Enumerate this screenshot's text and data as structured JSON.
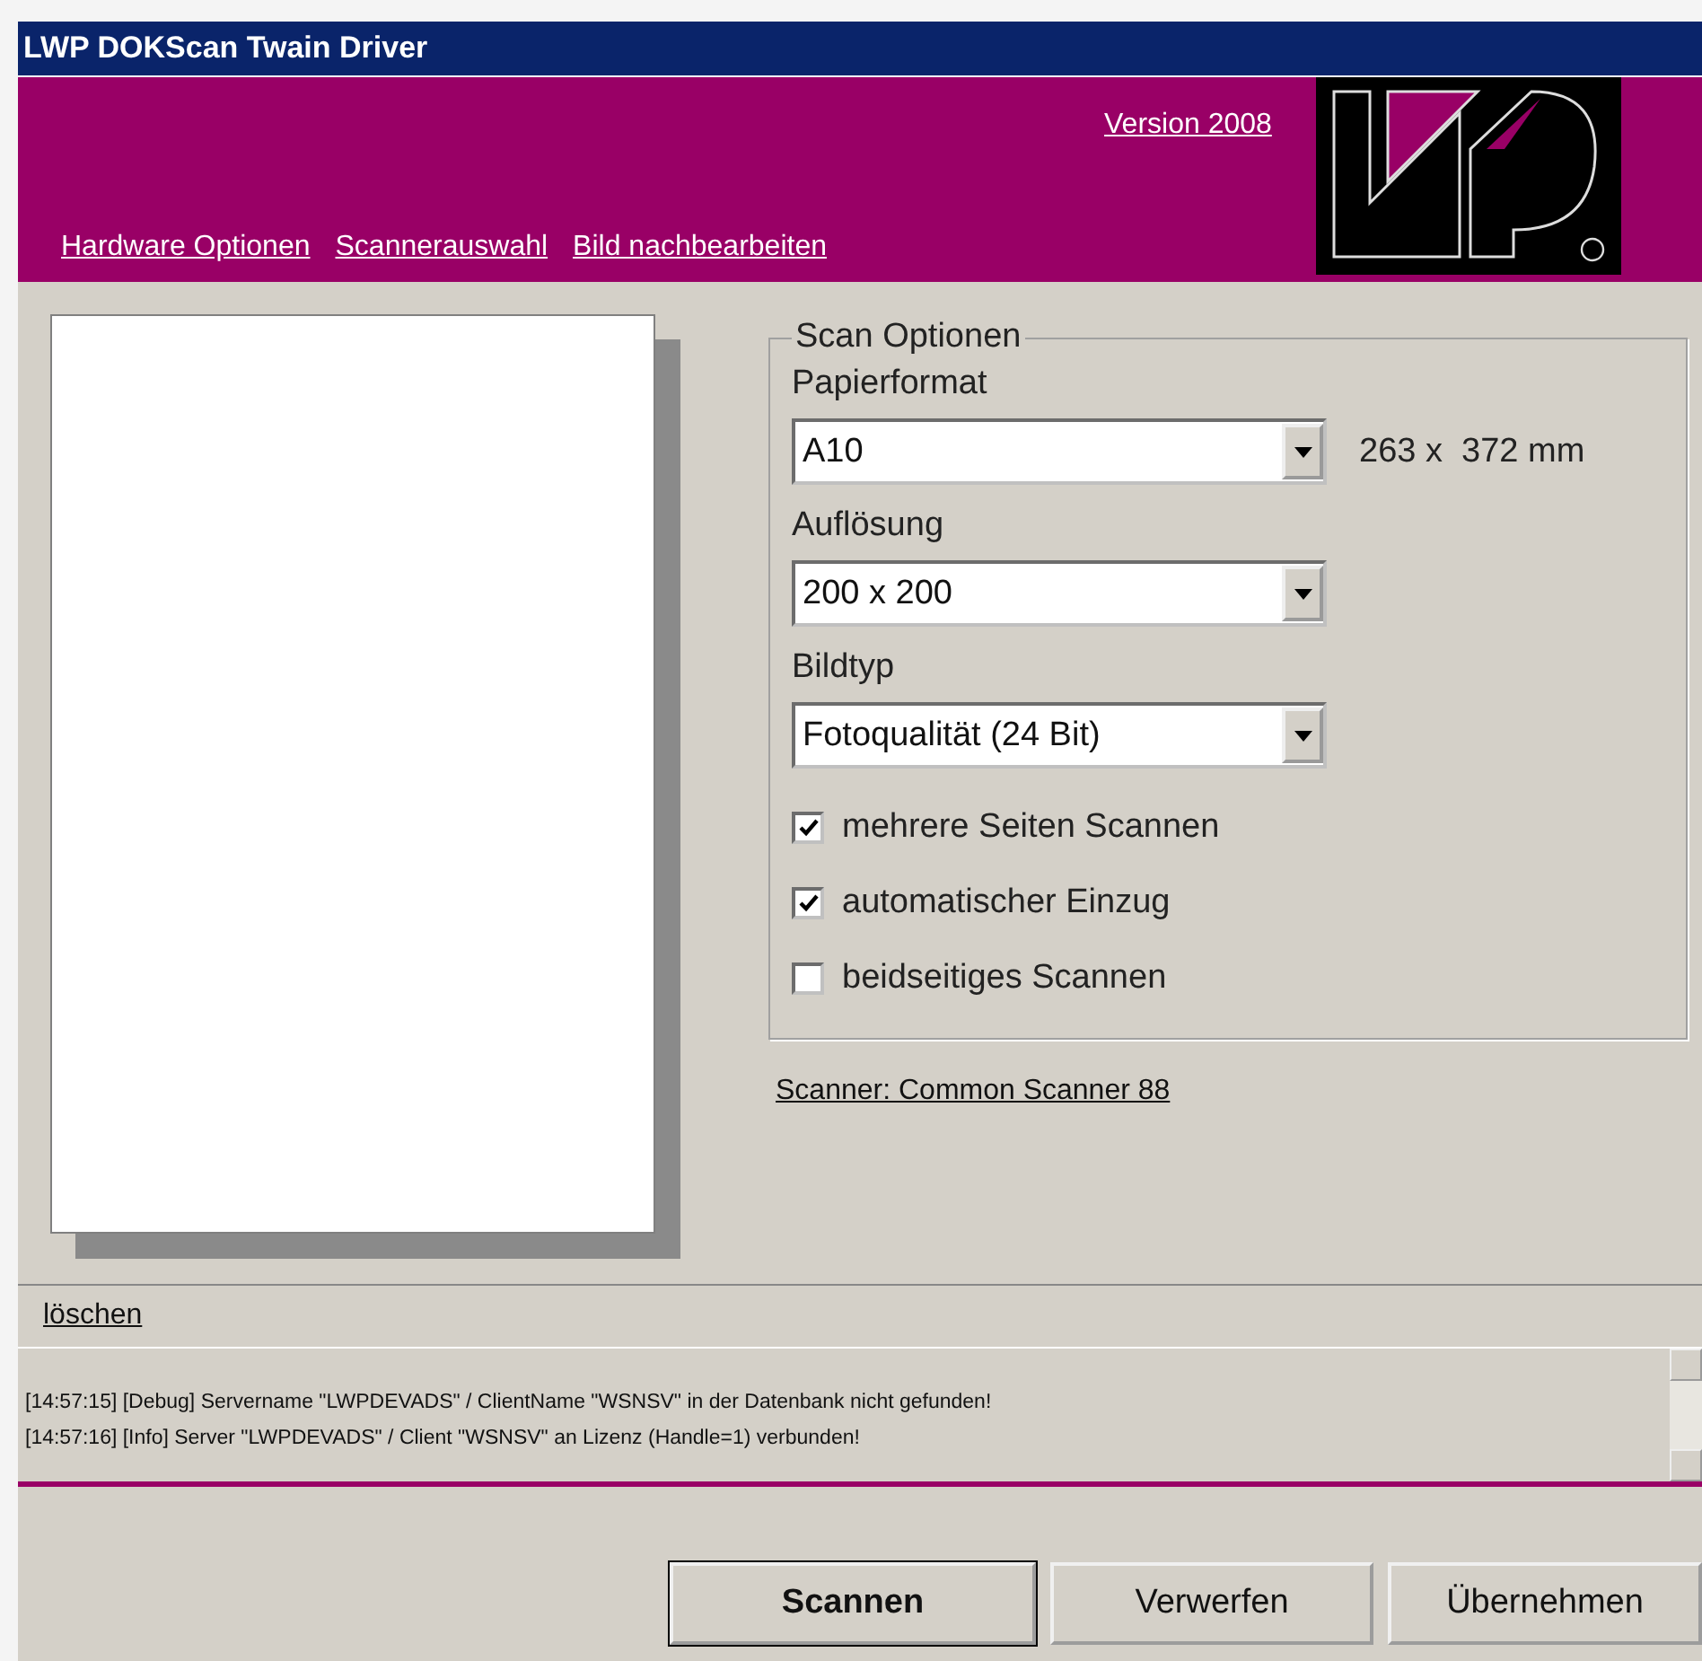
{
  "window": {
    "title": "LWP DOKScan Twain Driver"
  },
  "header": {
    "version_link": "Version 2008",
    "nav_links": [
      "Hardware Optionen",
      "Scannerauswahl",
      "Bild nachbearbeiten"
    ]
  },
  "scan_options": {
    "title": "Scan Optionen",
    "dropdowns": [
      {
        "label": "Papierformat",
        "value": "A10",
        "reading": "263 x  372 mm"
      },
      {
        "label": "Auflösung",
        "value": "200 x 200"
      },
      {
        "label": "Bildtyp",
        "value": "Fotoqualität (24 Bit)"
      }
    ],
    "checkboxes": [
      {
        "label": "mehrere Seiten Scannen",
        "checked": true
      },
      {
        "label": "automatischer Einzug",
        "checked": true
      },
      {
        "label": "beidseitiges Scannen",
        "checked": false
      }
    ]
  },
  "scanner_link": "Scanner: Common Scanner 88",
  "log": {
    "clear_link": "löschen",
    "lines": [
      "[14:57:15] [Debug] Servername \"LWPDEVADS\" / ClientName \"WSNSV\" in der Datenbank nicht gefunden!",
      "[14:57:16] [Info] Server \"LWPDEVADS\" / Client \"WSNSV\" an Lizenz (Handle=1) verbunden!"
    ]
  },
  "buttons": [
    {
      "label": "Scannen",
      "default": true
    },
    {
      "label": "Verwerfen",
      "default": false
    },
    {
      "label": "Übernehmen",
      "default": false
    }
  ]
}
